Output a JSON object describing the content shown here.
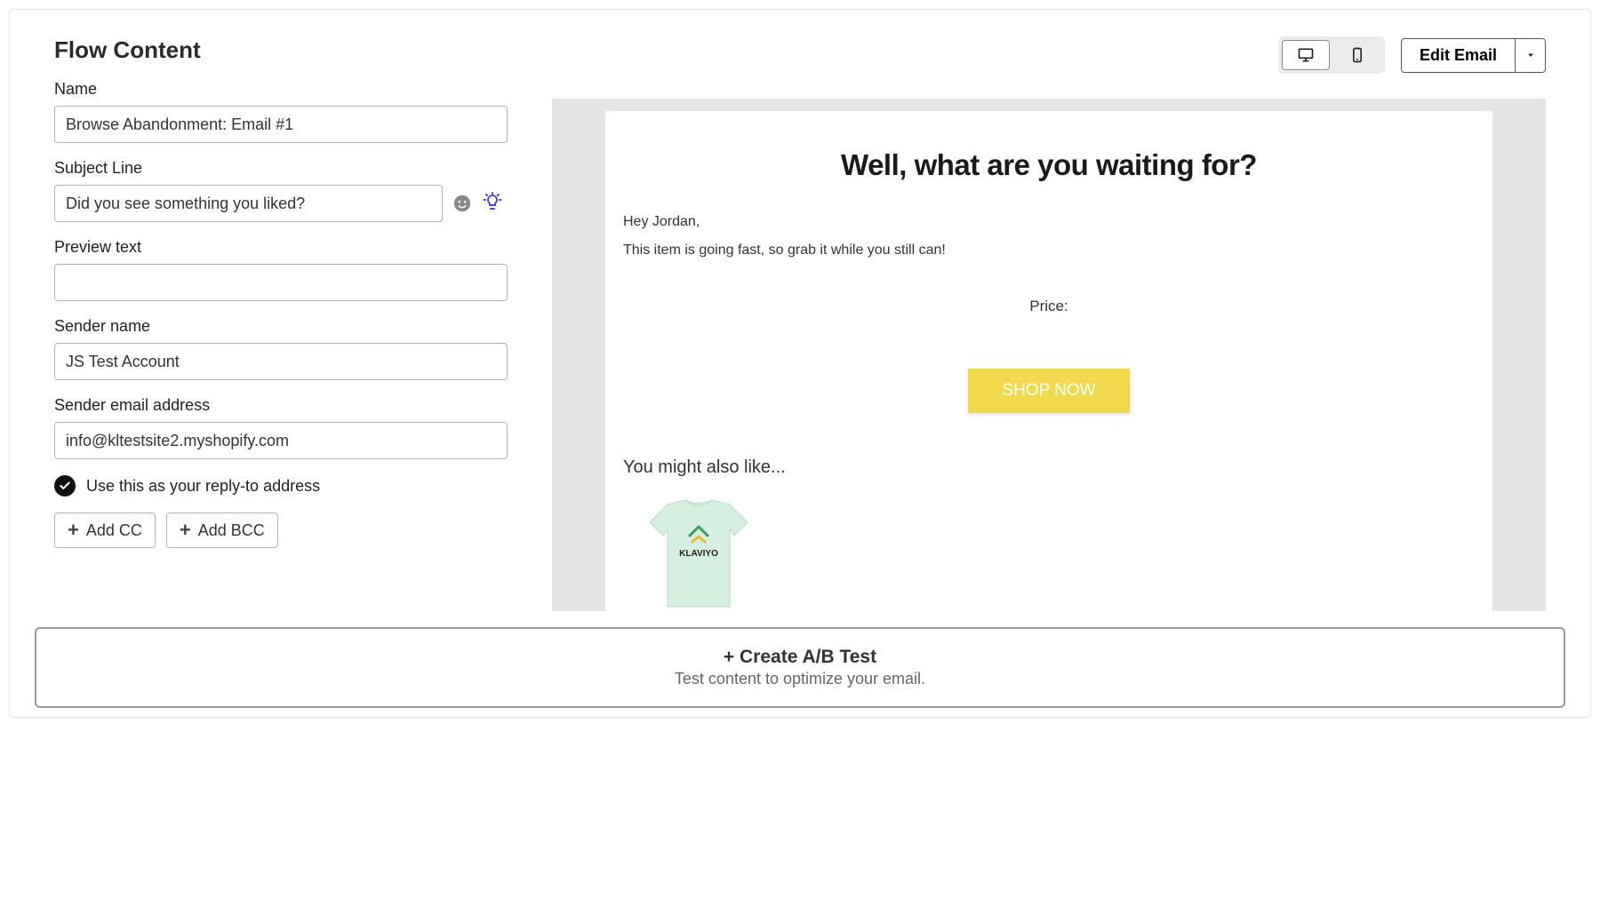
{
  "page_title": "Flow Content",
  "fields": {
    "name": {
      "label": "Name",
      "value": "Browse Abandonment: Email #1"
    },
    "subject": {
      "label": "Subject Line",
      "value": "Did you see something you liked?"
    },
    "preview": {
      "label": "Preview text",
      "value": ""
    },
    "sender_name": {
      "label": "Sender name",
      "value": "JS Test Account"
    },
    "sender_email": {
      "label": "Sender email address",
      "value": "info@kltestsite2.myshopify.com"
    }
  },
  "reply_to_label": "Use this as your reply-to address",
  "add_cc_label": "Add CC",
  "add_bcc_label": "Add BCC",
  "edit_email_label": "Edit Email",
  "preview": {
    "headline": "Well, what are you waiting for?",
    "greeting": "Hey Jordan,",
    "body": "This item is going fast, so grab it while you still can!",
    "price_label": "Price:",
    "shop_button": "SHOP NOW",
    "also_like": "You might also like...",
    "product_logo_text": "KLAVIYO"
  },
  "ab_test": {
    "title": "+ Create A/B Test",
    "subtitle": "Test content to optimize your email."
  }
}
